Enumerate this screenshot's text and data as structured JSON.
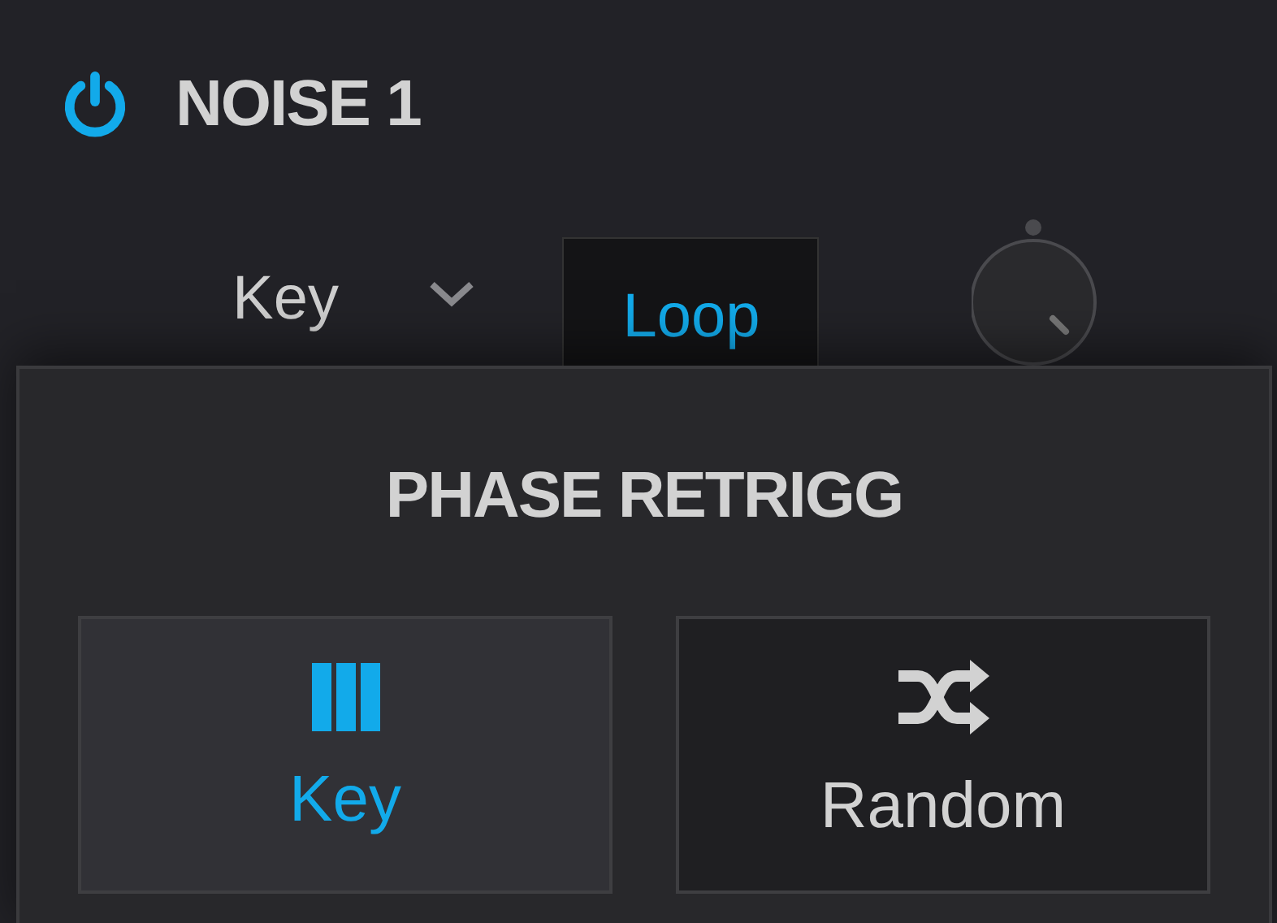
{
  "module": {
    "title": "NOISE 1",
    "on": true
  },
  "controls": {
    "retrig_mode": "Key",
    "loop": {
      "label": "Loop",
      "on": true
    }
  },
  "popup": {
    "title": "PHASE RETRIGG",
    "options": [
      {
        "label": "Key",
        "kind": "piano",
        "selected": true
      },
      {
        "label": "Random",
        "kind": "shuffle",
        "selected": false
      }
    ]
  }
}
